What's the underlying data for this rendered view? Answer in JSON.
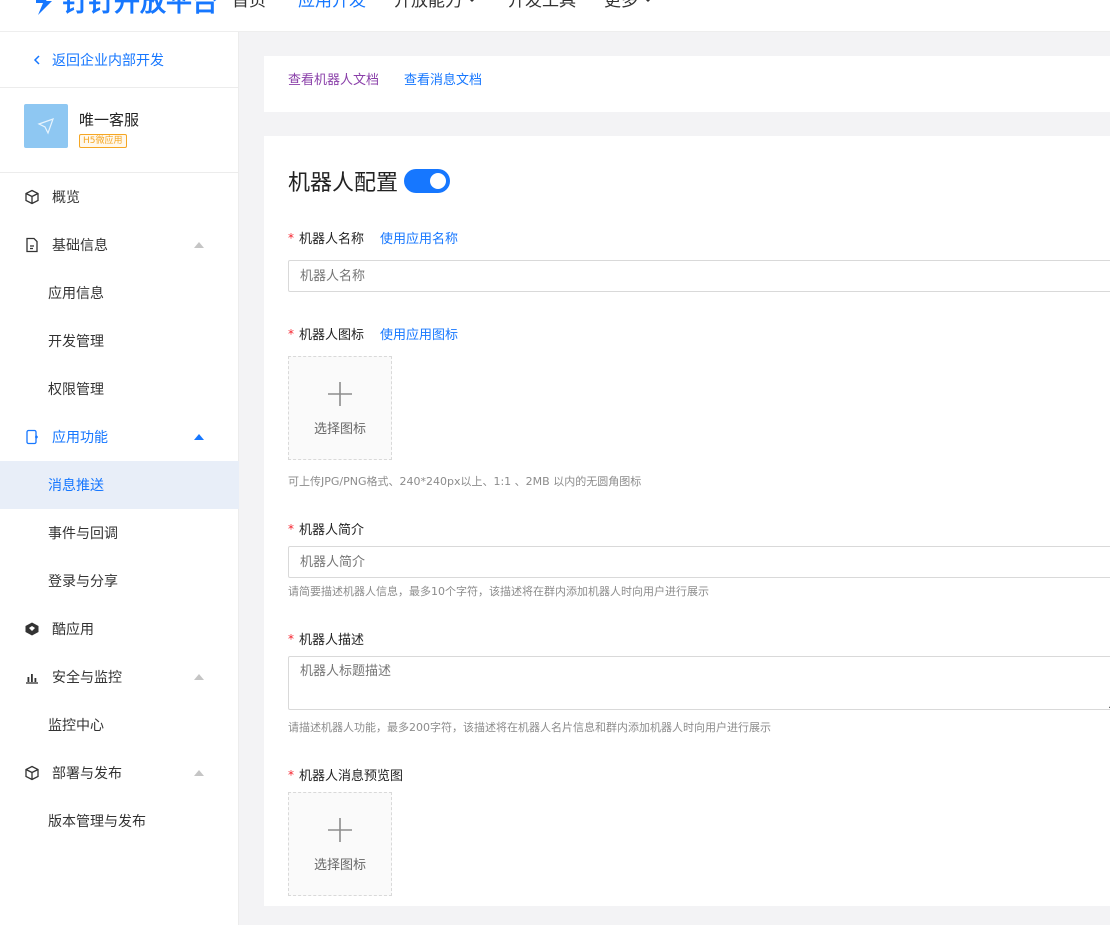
{
  "topnav": {
    "logo_text": "钉钉开放平台",
    "items": [
      {
        "label": "首页"
      },
      {
        "label": "应用开发"
      },
      {
        "label": "开放能力"
      },
      {
        "label": "开发工具"
      },
      {
        "label": "更多"
      }
    ]
  },
  "sidebar": {
    "back_label": "返回企业内部开发",
    "app": {
      "name": "唯一客服",
      "tag": "H5微应用"
    },
    "menu": {
      "overview": "概览",
      "basic_info": "基础信息",
      "app_info": "应用信息",
      "dev_manage": "开发管理",
      "perm_manage": "权限管理",
      "app_features": "应用功能",
      "msg_push": "消息推送",
      "event_callback": "事件与回调",
      "login_share": "登录与分享",
      "cool_app": "酷应用",
      "security": "安全与监控",
      "monitor_center": "监控中心",
      "deploy": "部署与发布",
      "version_manage": "版本管理与发布"
    }
  },
  "doc_links": {
    "robot_doc": "查看机器人文档",
    "msg_doc": "查看消息文档"
  },
  "form": {
    "title": "机器人配置",
    "toggle_on": true,
    "required_mark": "*",
    "name_label": "机器人名称",
    "name_link": "使用应用名称",
    "name_placeholder": "机器人名称",
    "icon_label": "机器人图标",
    "icon_link": "使用应用图标",
    "upload_text": "选择图标",
    "icon_hint": "可上传JPG/PNG格式、240*240px以上、1:1 、2MB 以内的无圆角图标",
    "intro_label": "机器人简介",
    "intro_placeholder": "机器人简介",
    "intro_hint": "请简要描述机器人信息，最多10个字符，该描述将在群内添加机器人时向用户进行展示",
    "desc_label": "机器人描述",
    "desc_placeholder": "机器人标题描述",
    "desc_hint": "请描述机器人功能，最多200字符，该描述将在机器人名片信息和群内添加机器人时向用户进行展示",
    "preview_label": "机器人消息预览图",
    "preview_upload_text": "选择图标"
  },
  "colors": {
    "accent": "#1677ff",
    "required": "#f5222d",
    "tag": "#f5a623"
  }
}
